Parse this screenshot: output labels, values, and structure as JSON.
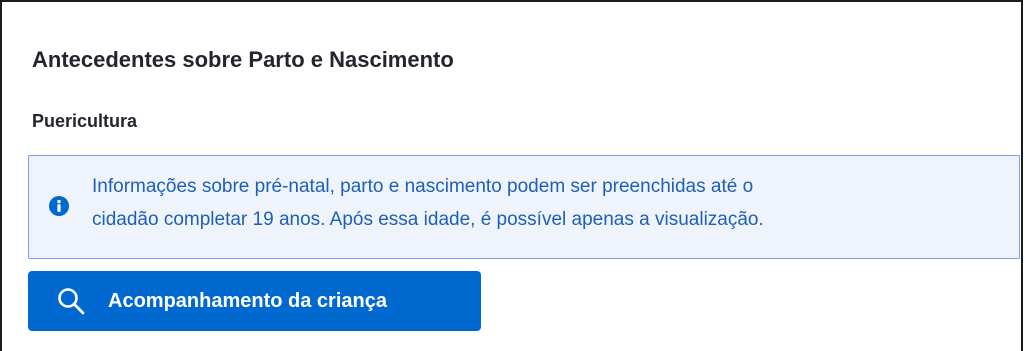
{
  "section": {
    "title": "Antecedentes sobre Parto e Nascimento",
    "subtitle": "Puericultura"
  },
  "alert": {
    "icon": "info-icon",
    "line1": "Informações sobre pré-natal, parto e nascimento podem ser preenchidas até o",
    "line2": "cidadão completar 19 anos. Após essa idade, é possível apenas a visualização."
  },
  "actions": {
    "child_followup": {
      "icon": "search-icon",
      "label": "Acompanhamento da criança"
    }
  },
  "colors": {
    "primary": "#0069d0",
    "alert_background": "#eef3fc",
    "alert_border": "#7fa3e3",
    "alert_text": "#1f5fb8",
    "heading_text": "#24252e"
  }
}
